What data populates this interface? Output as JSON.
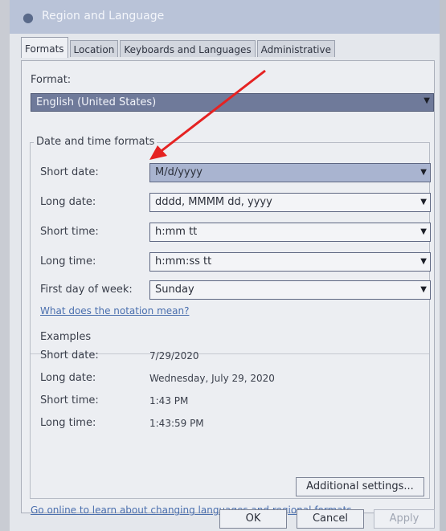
{
  "window": {
    "title": "Region and Language"
  },
  "tabs": [
    {
      "label": "Formats",
      "active": true
    },
    {
      "label": "Location",
      "active": false
    },
    {
      "label": "Keyboards and Languages",
      "active": false
    },
    {
      "label": "Administrative",
      "active": false
    }
  ],
  "format": {
    "label": "Format:",
    "value": "English (United States)"
  },
  "datetime_group": {
    "title": "Date and time formats",
    "rows": [
      {
        "label": "Short date:",
        "value": "M/d/yyyy"
      },
      {
        "label": "Long date:",
        "value": "dddd, MMMM dd, yyyy"
      },
      {
        "label": "Short time:",
        "value": "h:mm tt"
      },
      {
        "label": "Long time:",
        "value": "h:mm:ss tt"
      },
      {
        "label": "First day of week:",
        "value": "Sunday"
      }
    ],
    "notation_link": "What does the notation mean?"
  },
  "examples": {
    "title": "Examples",
    "rows": [
      {
        "label": "Short date:",
        "value": "7/29/2020"
      },
      {
        "label": "Long date:",
        "value": "Wednesday, July 29, 2020"
      },
      {
        "label": "Short time:",
        "value": "1:43 PM"
      },
      {
        "label": "Long time:",
        "value": "1:43:59 PM"
      }
    ]
  },
  "additional_settings": "Additional settings...",
  "online_link": "Go online to learn about changing languages and regional formats",
  "buttons": {
    "ok": "OK",
    "cancel": "Cancel",
    "apply": "Apply"
  },
  "annotation": {
    "arrow_color": "#e52222"
  },
  "colors": {
    "selected_format_bg": "#6f7a9a",
    "link": "#4a6fae"
  }
}
